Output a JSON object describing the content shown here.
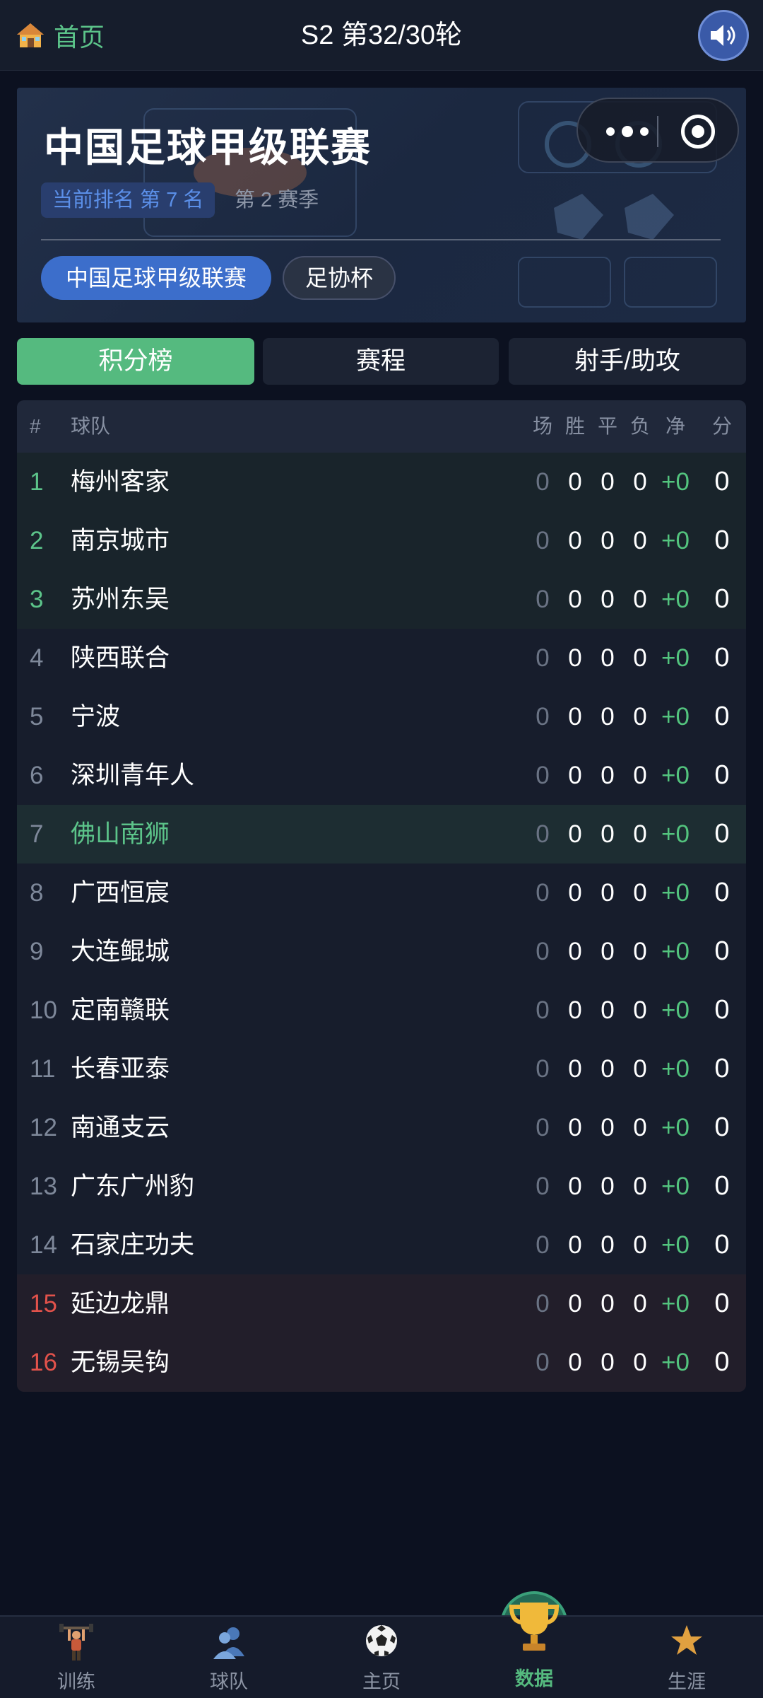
{
  "header": {
    "home_label": "首页",
    "round_title": "S2 第32/30轮"
  },
  "league": {
    "title": "中国足球甲级联赛",
    "rank_text": "当前排名 第 7 名",
    "season_text": "第 2 赛季",
    "tabs": [
      {
        "label": "中国足球甲级联赛",
        "active": true
      },
      {
        "label": "足协杯",
        "active": false
      }
    ]
  },
  "section_tabs": [
    {
      "label": "积分榜",
      "active": true
    },
    {
      "label": "赛程",
      "active": false
    },
    {
      "label": "射手/助攻",
      "active": false
    }
  ],
  "table": {
    "headers": {
      "rank": "#",
      "team": "球队",
      "played": "场",
      "won": "胜",
      "drawn": "平",
      "lost": "负",
      "gd": "净",
      "pts": "分"
    },
    "rows": [
      {
        "rank": "1",
        "team": "梅州客家",
        "p": "0",
        "w": "0",
        "d": "0",
        "l": "0",
        "gd": "+0",
        "pts": "0",
        "zone": "top"
      },
      {
        "rank": "2",
        "team": "南京城市",
        "p": "0",
        "w": "0",
        "d": "0",
        "l": "0",
        "gd": "+0",
        "pts": "0",
        "zone": "top"
      },
      {
        "rank": "3",
        "team": "苏州东吴",
        "p": "0",
        "w": "0",
        "d": "0",
        "l": "0",
        "gd": "+0",
        "pts": "0",
        "zone": "top"
      },
      {
        "rank": "4",
        "team": "陕西联合",
        "p": "0",
        "w": "0",
        "d": "0",
        "l": "0",
        "gd": "+0",
        "pts": "0",
        "zone": "mid"
      },
      {
        "rank": "5",
        "team": "宁波",
        "p": "0",
        "w": "0",
        "d": "0",
        "l": "0",
        "gd": "+0",
        "pts": "0",
        "zone": "mid"
      },
      {
        "rank": "6",
        "team": "深圳青年人",
        "p": "0",
        "w": "0",
        "d": "0",
        "l": "0",
        "gd": "+0",
        "pts": "0",
        "zone": "mid"
      },
      {
        "rank": "7",
        "team": "佛山南狮",
        "p": "0",
        "w": "0",
        "d": "0",
        "l": "0",
        "gd": "+0",
        "pts": "0",
        "zone": "mine"
      },
      {
        "rank": "8",
        "team": "广西恒宸",
        "p": "0",
        "w": "0",
        "d": "0",
        "l": "0",
        "gd": "+0",
        "pts": "0",
        "zone": "mid"
      },
      {
        "rank": "9",
        "team": "大连鲲城",
        "p": "0",
        "w": "0",
        "d": "0",
        "l": "0",
        "gd": "+0",
        "pts": "0",
        "zone": "mid"
      },
      {
        "rank": "10",
        "team": "定南赣联",
        "p": "0",
        "w": "0",
        "d": "0",
        "l": "0",
        "gd": "+0",
        "pts": "0",
        "zone": "mid"
      },
      {
        "rank": "11",
        "team": "长春亚泰",
        "p": "0",
        "w": "0",
        "d": "0",
        "l": "0",
        "gd": "+0",
        "pts": "0",
        "zone": "mid"
      },
      {
        "rank": "12",
        "team": "南通支云",
        "p": "0",
        "w": "0",
        "d": "0",
        "l": "0",
        "gd": "+0",
        "pts": "0",
        "zone": "mid"
      },
      {
        "rank": "13",
        "team": "广东广州豹",
        "p": "0",
        "w": "0",
        "d": "0",
        "l": "0",
        "gd": "+0",
        "pts": "0",
        "zone": "mid"
      },
      {
        "rank": "14",
        "team": "石家庄功夫",
        "p": "0",
        "w": "0",
        "d": "0",
        "l": "0",
        "gd": "+0",
        "pts": "0",
        "zone": "mid"
      },
      {
        "rank": "15",
        "team": "延边龙鼎",
        "p": "0",
        "w": "0",
        "d": "0",
        "l": "0",
        "gd": "+0",
        "pts": "0",
        "zone": "bottom"
      },
      {
        "rank": "16",
        "team": "无锡吴钩",
        "p": "0",
        "w": "0",
        "d": "0",
        "l": "0",
        "gd": "+0",
        "pts": "0",
        "zone": "bottom"
      }
    ]
  },
  "bottom_nav": [
    {
      "label": "训练",
      "icon": "weightlifter-icon",
      "active": false
    },
    {
      "label": "球队",
      "icon": "players-icon",
      "active": false
    },
    {
      "label": "主页",
      "icon": "soccer-ball-icon",
      "active": false
    },
    {
      "label": "数据",
      "icon": "trophy-icon",
      "active": true
    },
    {
      "label": "生涯",
      "icon": "star-icon",
      "active": false
    }
  ],
  "colors": {
    "accent_green": "#55ba7f",
    "accent_blue": "#3c6ecb",
    "relegation_red": "#e2524b",
    "background": "#0c1120"
  }
}
